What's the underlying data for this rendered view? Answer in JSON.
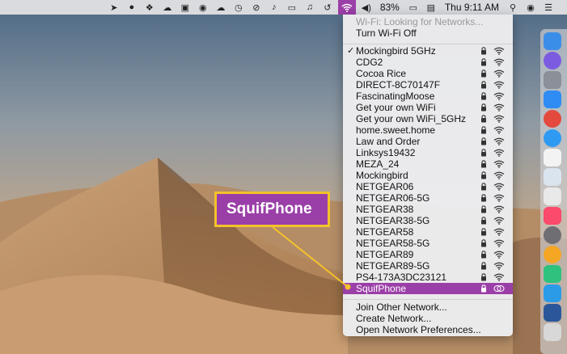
{
  "menubar": {
    "battery_pct": "83%",
    "clock": "Thu 9:11 AM",
    "icons": [
      "location-arrow-icon",
      "grid-icon",
      "dropbox-icon",
      "cloud-sync-icon",
      "screen-icon",
      "lock-icon",
      "cloud-upload-icon",
      "clock-icon",
      "block-icon",
      "bell-icon",
      "airplay-icon",
      "microphone-icon",
      "history-icon",
      "wifi-icon",
      "volume-icon",
      "display-icon",
      "search-icon",
      "siri-icon",
      "list-icon"
    ]
  },
  "wifi_menu": {
    "status": "Wi-Fi: Looking for Networks...",
    "toggle": "Turn Wi-Fi Off",
    "networks": [
      {
        "name": "Mockingbird 5GHz",
        "connected": true,
        "locked": true
      },
      {
        "name": "CDG2",
        "connected": false,
        "locked": true
      },
      {
        "name": "Cocoa Rice",
        "connected": false,
        "locked": true
      },
      {
        "name": "DIRECT-8C70147F",
        "connected": false,
        "locked": true
      },
      {
        "name": "FascinatingMoose",
        "connected": false,
        "locked": true
      },
      {
        "name": "Get your own WiFi",
        "connected": false,
        "locked": true
      },
      {
        "name": "Get your own WiFi_5GHz",
        "connected": false,
        "locked": true
      },
      {
        "name": "home.sweet.home",
        "connected": false,
        "locked": true
      },
      {
        "name": "Law and Order",
        "connected": false,
        "locked": true
      },
      {
        "name": "Linksys19432",
        "connected": false,
        "locked": true
      },
      {
        "name": "MEZA_24",
        "connected": false,
        "locked": true
      },
      {
        "name": "Mockingbird",
        "connected": false,
        "locked": true
      },
      {
        "name": "NETGEAR06",
        "connected": false,
        "locked": true
      },
      {
        "name": "NETGEAR06-5G",
        "connected": false,
        "locked": true
      },
      {
        "name": "NETGEAR38",
        "connected": false,
        "locked": true
      },
      {
        "name": "NETGEAR38-5G",
        "connected": false,
        "locked": true
      },
      {
        "name": "NETGEAR58",
        "connected": false,
        "locked": true
      },
      {
        "name": "NETGEAR58-5G",
        "connected": false,
        "locked": true
      },
      {
        "name": "NETGEAR89",
        "connected": false,
        "locked": true
      },
      {
        "name": "NETGEAR89-5G",
        "connected": false,
        "locked": true
      },
      {
        "name": "PS4-173A3DC23121",
        "connected": false,
        "locked": true
      },
      {
        "name": "SquifPhone",
        "connected": false,
        "locked": true,
        "highlighted": true,
        "hotspot": true
      }
    ],
    "join_other": "Join Other Network...",
    "create": "Create Network...",
    "open_prefs": "Open Network Preferences..."
  },
  "callout": {
    "label": "SquifPhone"
  },
  "colors": {
    "highlight": "#9b3fa8",
    "callout_border": "#f3c12b"
  }
}
